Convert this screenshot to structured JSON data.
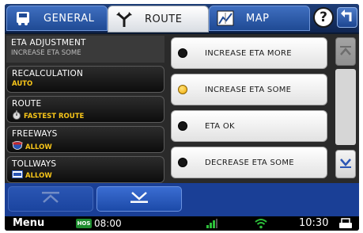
{
  "tabs": {
    "general": {
      "label": "GENERAL",
      "icon": "truck-icon"
    },
    "route": {
      "label": "ROUTE",
      "icon": "route-fork-icon"
    },
    "map": {
      "label": "MAP",
      "icon": "map-icon"
    }
  },
  "header": {
    "help_label": "?",
    "back_icon": "back-arrow-icon"
  },
  "settings": [
    {
      "title": "ETA ADJUSTMENT",
      "value": "INCREASE ETA SOME"
    },
    {
      "title": "RECALCULATION",
      "value": "AUTO"
    },
    {
      "title": "ROUTE",
      "value": "FASTEST ROUTE",
      "icon": "stopwatch-icon"
    },
    {
      "title": "FREEWAYS",
      "value": "ALLOW",
      "icon": "freeway-shield-icon"
    },
    {
      "title": "TOLLWAYS",
      "value": "ALLOW",
      "icon": "toll-sign-icon"
    }
  ],
  "options": [
    {
      "label": "INCREASE ETA MORE",
      "selected": false
    },
    {
      "label": "INCREASE ETA SOME",
      "selected": true
    },
    {
      "label": "ETA OK",
      "selected": false
    },
    {
      "label": "DECREASE ETA SOME",
      "selected": false
    }
  ],
  "status": {
    "menu_label": "Menu",
    "hos_label": "HOS",
    "hos_time": "08:00",
    "clock": "10:30"
  },
  "colors": {
    "accent_yellow": "#f7c519",
    "nav_blue": "#1a3f96",
    "hos_green": "#1d8c2e"
  }
}
